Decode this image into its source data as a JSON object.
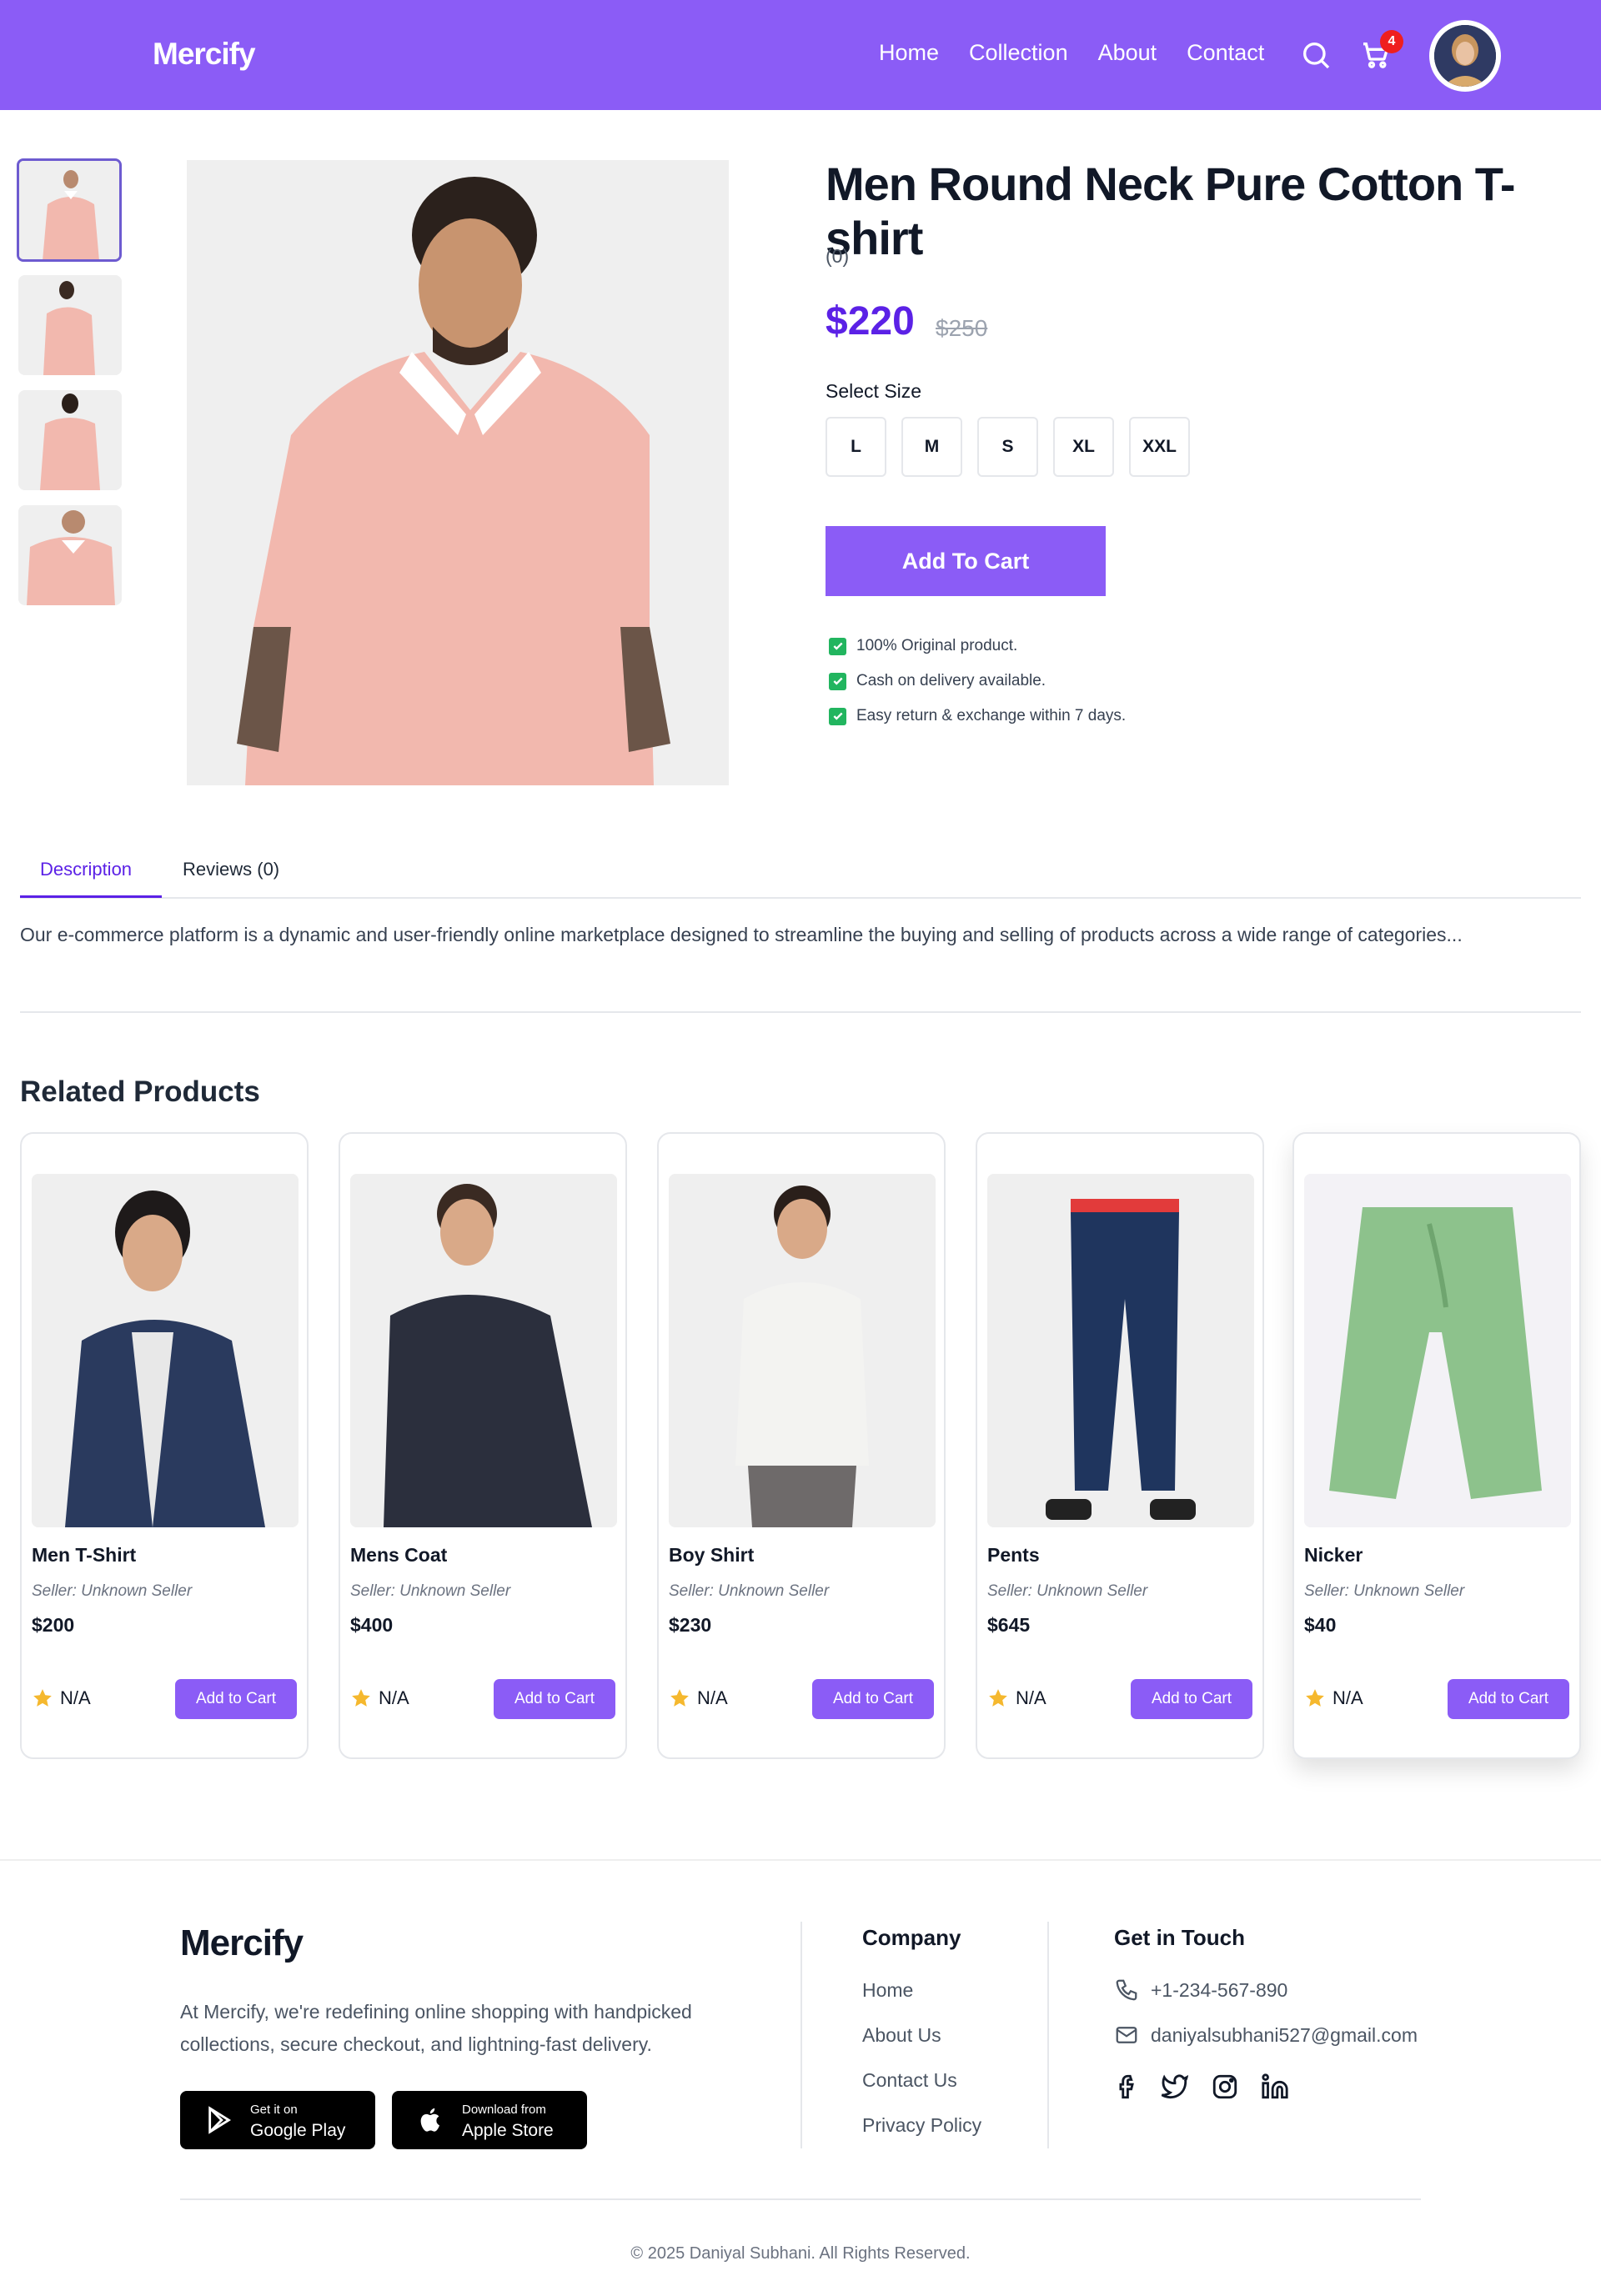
{
  "header": {
    "logo": "Mercify",
    "nav": [
      "Home",
      "Collection",
      "About",
      "Contact"
    ],
    "cart_count": "4"
  },
  "product": {
    "title": "Men Round Neck Pure Cotton T-shirt",
    "rating": "(0)",
    "price": "$220",
    "old_price": "$250",
    "size_label": "Select Size",
    "sizes": [
      "L",
      "M",
      "S",
      "XL",
      "XXL"
    ],
    "add_to_cart": "Add To Cart",
    "features": [
      "100% Original product.",
      "Cash on delivery available.",
      "Easy return & exchange within 7 days."
    ]
  },
  "tabs": {
    "description": "Description",
    "reviews": "Reviews (0)",
    "description_text": "Our e-commerce platform is a dynamic and user-friendly online marketplace designed to streamline the buying and selling of products across a wide range of categories..."
  },
  "related": {
    "title": "Related Products",
    "products": [
      {
        "name": "Men T-Shirt",
        "seller": "Seller: Unknown Seller",
        "price": "$200",
        "rating": "N/A",
        "button": "Add to Cart"
      },
      {
        "name": "Mens Coat",
        "seller": "Seller: Unknown Seller",
        "price": "$400",
        "rating": "N/A",
        "button": "Add to Cart"
      },
      {
        "name": "Boy Shirt",
        "seller": "Seller: Unknown Seller",
        "price": "$230",
        "rating": "N/A",
        "button": "Add to Cart"
      },
      {
        "name": "Pents",
        "seller": "Seller: Unknown Seller",
        "price": "$645",
        "rating": "N/A",
        "button": "Add to Cart"
      },
      {
        "name": "Nicker",
        "seller": "Seller: Unknown Seller",
        "price": "$40",
        "rating": "N/A",
        "button": "Add to Cart"
      }
    ]
  },
  "footer": {
    "logo": "Mercify",
    "about": "At Mercify, we're redefining online shopping with handpicked collections, secure checkout, and lightning-fast delivery.",
    "google_small": "Get it on",
    "google_large": "Google Play",
    "apple_small": "Download from",
    "apple_large": "Apple Store",
    "company_head": "Company",
    "company_links": [
      "Home",
      "About Us",
      "Contact Us",
      "Privacy Policy"
    ],
    "contact_head": "Get in Touch",
    "phone": "+1-234-567-890",
    "email": "daniyalsubhani527@gmail.com",
    "copyright": "© 2025 Daniyal Subhani. All Rights Reserved."
  },
  "colors": {
    "brand": "#8b5cf6",
    "price": "#5b21e6",
    "badge": "#ef1f1f",
    "check": "#22b55f"
  },
  "icons": [
    "search-icon",
    "cart-icon",
    "facebook-icon",
    "twitter-icon",
    "instagram-icon",
    "linkedin-icon",
    "phone-icon",
    "mail-icon",
    "star-icon",
    "google-play-icon",
    "apple-icon",
    "check-icon"
  ]
}
